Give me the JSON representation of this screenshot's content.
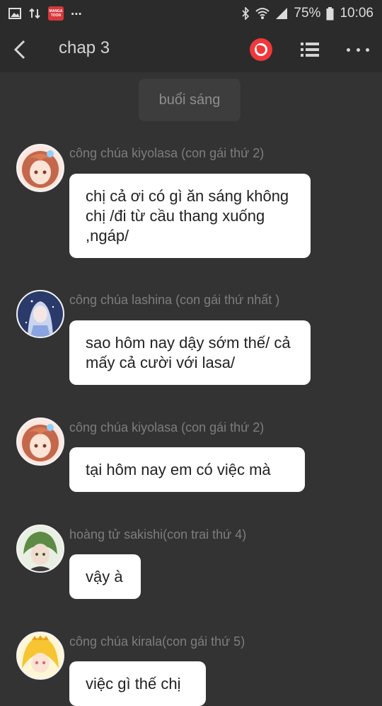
{
  "status_bar": {
    "app_badge_text": "MANGA TOON",
    "ellipsis": "...",
    "battery": "75%",
    "time": "10:06"
  },
  "header": {
    "title": "chap 3"
  },
  "scene": {
    "label": "buổi sáng"
  },
  "messages": [
    {
      "sender": "công chúa kiyolasa (con gái  thứ 2)",
      "text": "chị cả ơi có gì ăn sáng không chị /đi từ cầu thang xuống ,ngáp/",
      "avatar": "girl-orange-hair-avatar"
    },
    {
      "sender": "công chúa lashina (con gái thứ nhất )",
      "text": "sao hôm nay dậy sớm thế/ cả mấy cả cười với lasa/",
      "avatar": "girl-silver-hair-avatar"
    },
    {
      "sender": "công chúa kiyolasa (con gái  thứ 2)",
      "text": "tại hôm nay em có việc mà",
      "avatar": "girl-orange-hair-avatar"
    },
    {
      "sender": "hoàng tử sakishi(con trai thứ 4)",
      "text": "vậy à",
      "avatar": "boy-green-hair-avatar"
    },
    {
      "sender": "công chúa kirala(con gái thứ 5)",
      "text": "việc gì thế chị",
      "avatar": "girl-yellow-hair-avatar"
    }
  ],
  "colors": {
    "background": "#333333",
    "bar": "#2b2b2b",
    "bubble": "#ffffff",
    "record_button": "#f0383b",
    "sender_text": "#7d7d7d"
  }
}
